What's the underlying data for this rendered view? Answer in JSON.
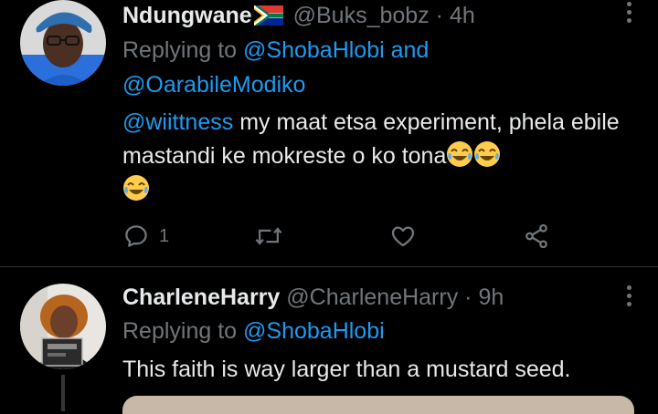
{
  "tweets": [
    {
      "display_name": "Ndungwane",
      "handle": "@Buks_bobz",
      "separator": "·",
      "time": "4h",
      "replying_prefix": "Replying to",
      "replying_to": [
        "@ShobaHlobi",
        "@OarabileModiko"
      ],
      "replying_joiner": "and",
      "body_mention": "@wiittness",
      "body_text": " my maat etsa experiment, phela ebile mastandi ke mokreste o ko tona",
      "emoji": [
        "face-with-tears-of-joy",
        "face-with-tears-of-joy",
        "face-with-tears-of-joy"
      ],
      "flag": "south-africa-flag",
      "actions": {
        "reply_count": "1",
        "retweet_count": "",
        "like_count": ""
      }
    },
    {
      "display_name": "CharleneHarry",
      "handle": "@CharleneHarry",
      "separator": "·",
      "time": "9h",
      "replying_prefix": "Replying to",
      "replying_to": [
        "@ShobaHlobi"
      ],
      "body_text": "This faith is way larger than a mustard seed."
    }
  ],
  "colors": {
    "background": "#000000",
    "text": "#e7e9ea",
    "muted": "#71767b",
    "link": "#1d9bf0",
    "divider": "#2f3336"
  },
  "icons": [
    "reply-icon",
    "retweet-icon",
    "like-icon",
    "share-icon",
    "more-icon"
  ]
}
